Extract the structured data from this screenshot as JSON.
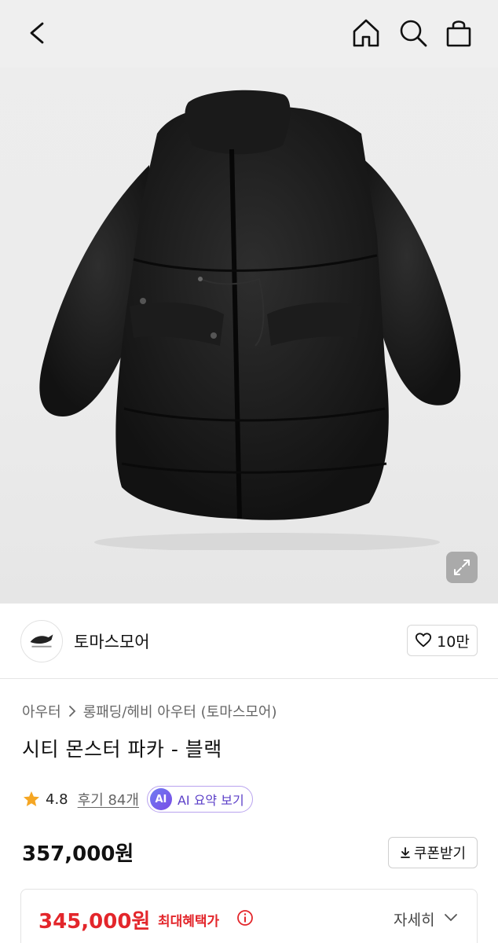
{
  "header": {
    "icons": [
      "back-arrow-icon",
      "home-icon",
      "search-icon",
      "shopping-bag-icon"
    ]
  },
  "product_image": {
    "icons": [
      "expand-icon"
    ]
  },
  "brand": {
    "name": "토마스모어",
    "like_count": "10만",
    "icons": [
      "brand-logo",
      "heart-icon"
    ]
  },
  "breadcrumb": {
    "category": "아우터",
    "subcategory": "롱패딩/헤비 아우터 (토마스모어)"
  },
  "product": {
    "title": "시티 몬스터 파카 - 블랙",
    "rating": "4.8",
    "reviews_label": "후기 84개",
    "ai_badge": "AI",
    "ai_summary_label": "AI 요약 보기",
    "price": "357,000원",
    "coupon_label": "쿠폰받기"
  },
  "benefit": {
    "max_price": "345,000원",
    "max_label": "최대혜택가",
    "detail_label": "자세히"
  },
  "colors": {
    "accent_red": "#e3262b",
    "ai_purple": "#5b3fc8",
    "star": "#f5a623"
  }
}
